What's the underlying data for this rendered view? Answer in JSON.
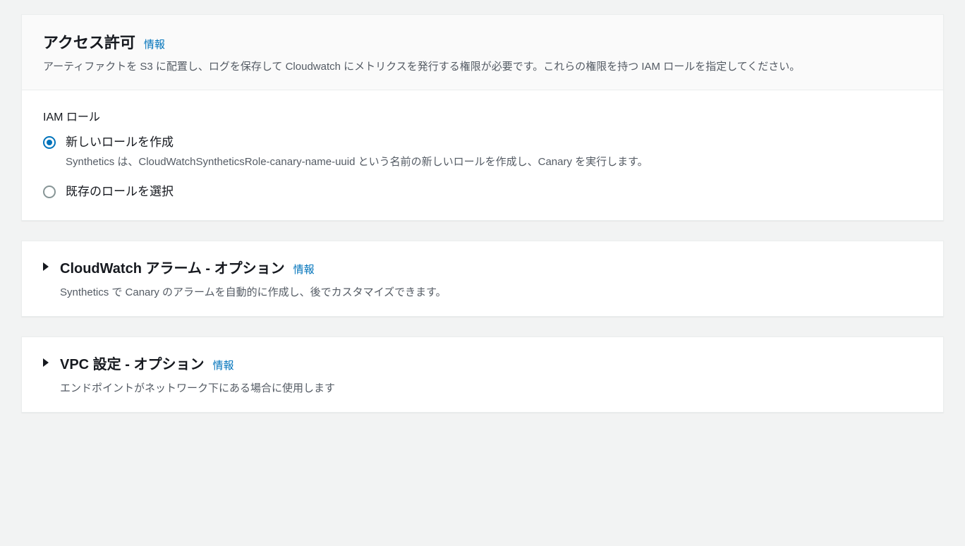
{
  "access": {
    "title": "アクセス許可",
    "info": "情報",
    "desc": "アーティファクトを S3 に配置し、ログを保存して Cloudwatch にメトリクスを発行する権限が必要です。これらの権限を持つ IAM ロールを指定してください。",
    "iam_label": "IAM ロール",
    "radio_new_label": "新しいロールを作成",
    "radio_new_sub": "Synthetics は、CloudWatchSyntheticsRole-canary-name-uuid という名前の新しいロールを作成し、Canary を実行します。",
    "radio_existing_label": "既存のロールを選択"
  },
  "alarms": {
    "title": "CloudWatch アラーム - オプション",
    "info": "情報",
    "desc": "Synthetics で Canary のアラームを自動的に作成し、後でカスタマイズできます。"
  },
  "vpc": {
    "title": "VPC 設定 - オプション",
    "info": "情報",
    "desc": "エンドポイントがネットワーク下にある場合に使用します"
  }
}
